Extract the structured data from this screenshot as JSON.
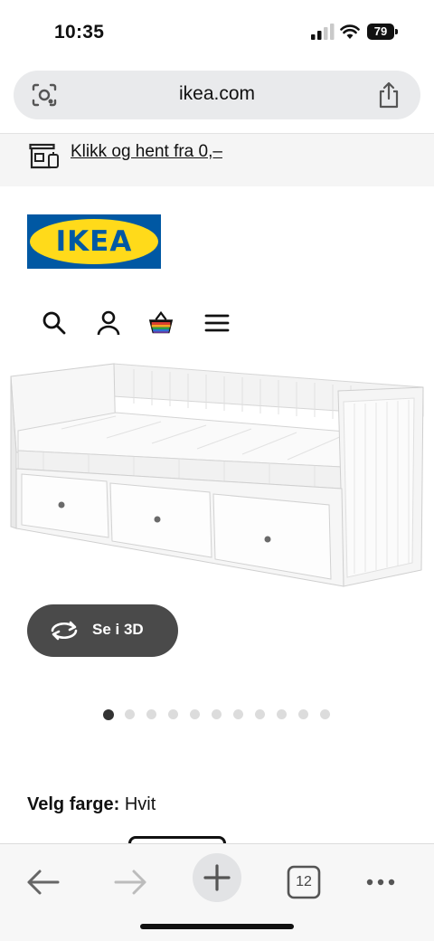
{
  "status_bar": {
    "time": "10:35",
    "battery": "79"
  },
  "browser": {
    "url": "ikea.com"
  },
  "promo": {
    "text": "Klikk og hent fra 0,–"
  },
  "brand": {
    "logo_text": "IKEA",
    "logo_blue": "#0058a3",
    "logo_yellow": "#ffda1a"
  },
  "nav": {
    "icons": [
      "search-icon",
      "account-icon",
      "shopping-bag-icon",
      "menu-icon"
    ]
  },
  "product": {
    "view_3d_label": "Se i 3D",
    "carousel": {
      "count": 11,
      "active": 1
    }
  },
  "color_select": {
    "label": "Velg farge:",
    "value": "Hvit"
  },
  "toolbar": {
    "tabs_count": "12"
  }
}
